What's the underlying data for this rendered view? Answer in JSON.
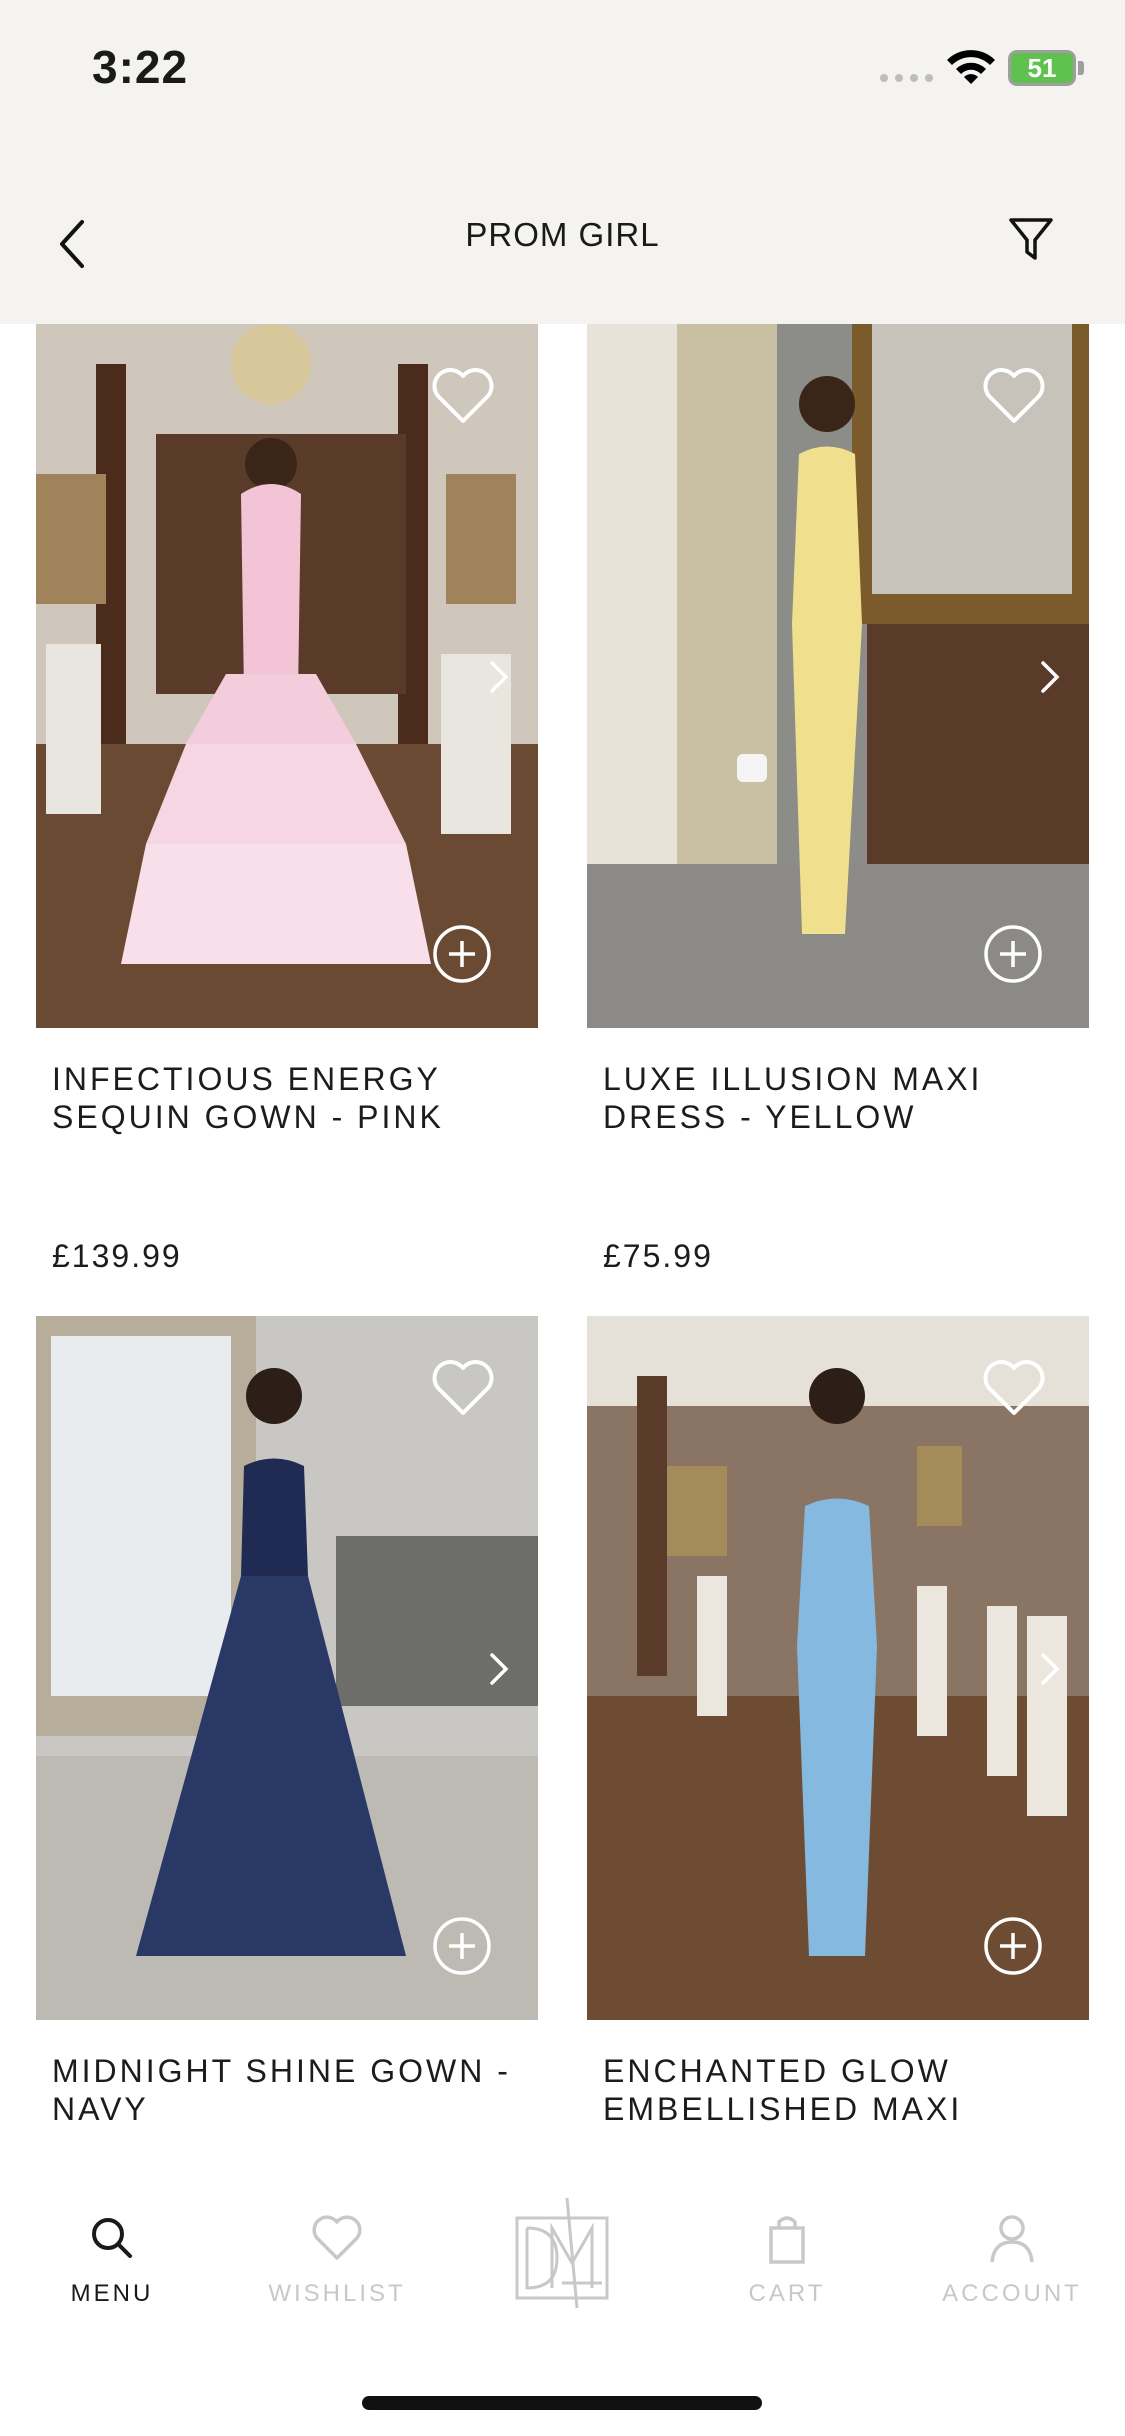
{
  "status": {
    "time": "3:22",
    "battery": "51"
  },
  "nav": {
    "title": "PROM GIRL"
  },
  "products": [
    {
      "name": "INFECTIOUS ENERGY SEQUIN GOWN - PINK",
      "price": "£139.99",
      "dress_color": "#f3c4d6"
    },
    {
      "name": "LUXE ILLUSION MAXI DRESS - YELLOW",
      "price": "£75.99",
      "dress_color": "#f0e08e"
    },
    {
      "name": "MIDNIGHT SHINE GOWN - NAVY",
      "price": "",
      "dress_color": "#1f2b52"
    },
    {
      "name": "ENCHANTED GLOW EMBELLISHED MAXI",
      "price": "",
      "dress_color": "#86b9e0"
    }
  ],
  "tabbar": {
    "items": [
      {
        "label": "MENU",
        "icon": "search-icon",
        "active": true
      },
      {
        "label": "WISHLIST",
        "icon": "heart-icon",
        "active": false
      },
      {
        "label": "",
        "icon": "dmz-logo",
        "active": false
      },
      {
        "label": "CART",
        "icon": "shopping-bag-icon",
        "active": false
      },
      {
        "label": "ACCOUNT",
        "icon": "person-icon",
        "active": false
      }
    ]
  },
  "colors": {
    "header_bg": "#f4f3f0",
    "active_tab": "#1a1a1a",
    "inactive_tab": "#c8c8c8",
    "overlay_icon": "#ffffff"
  }
}
